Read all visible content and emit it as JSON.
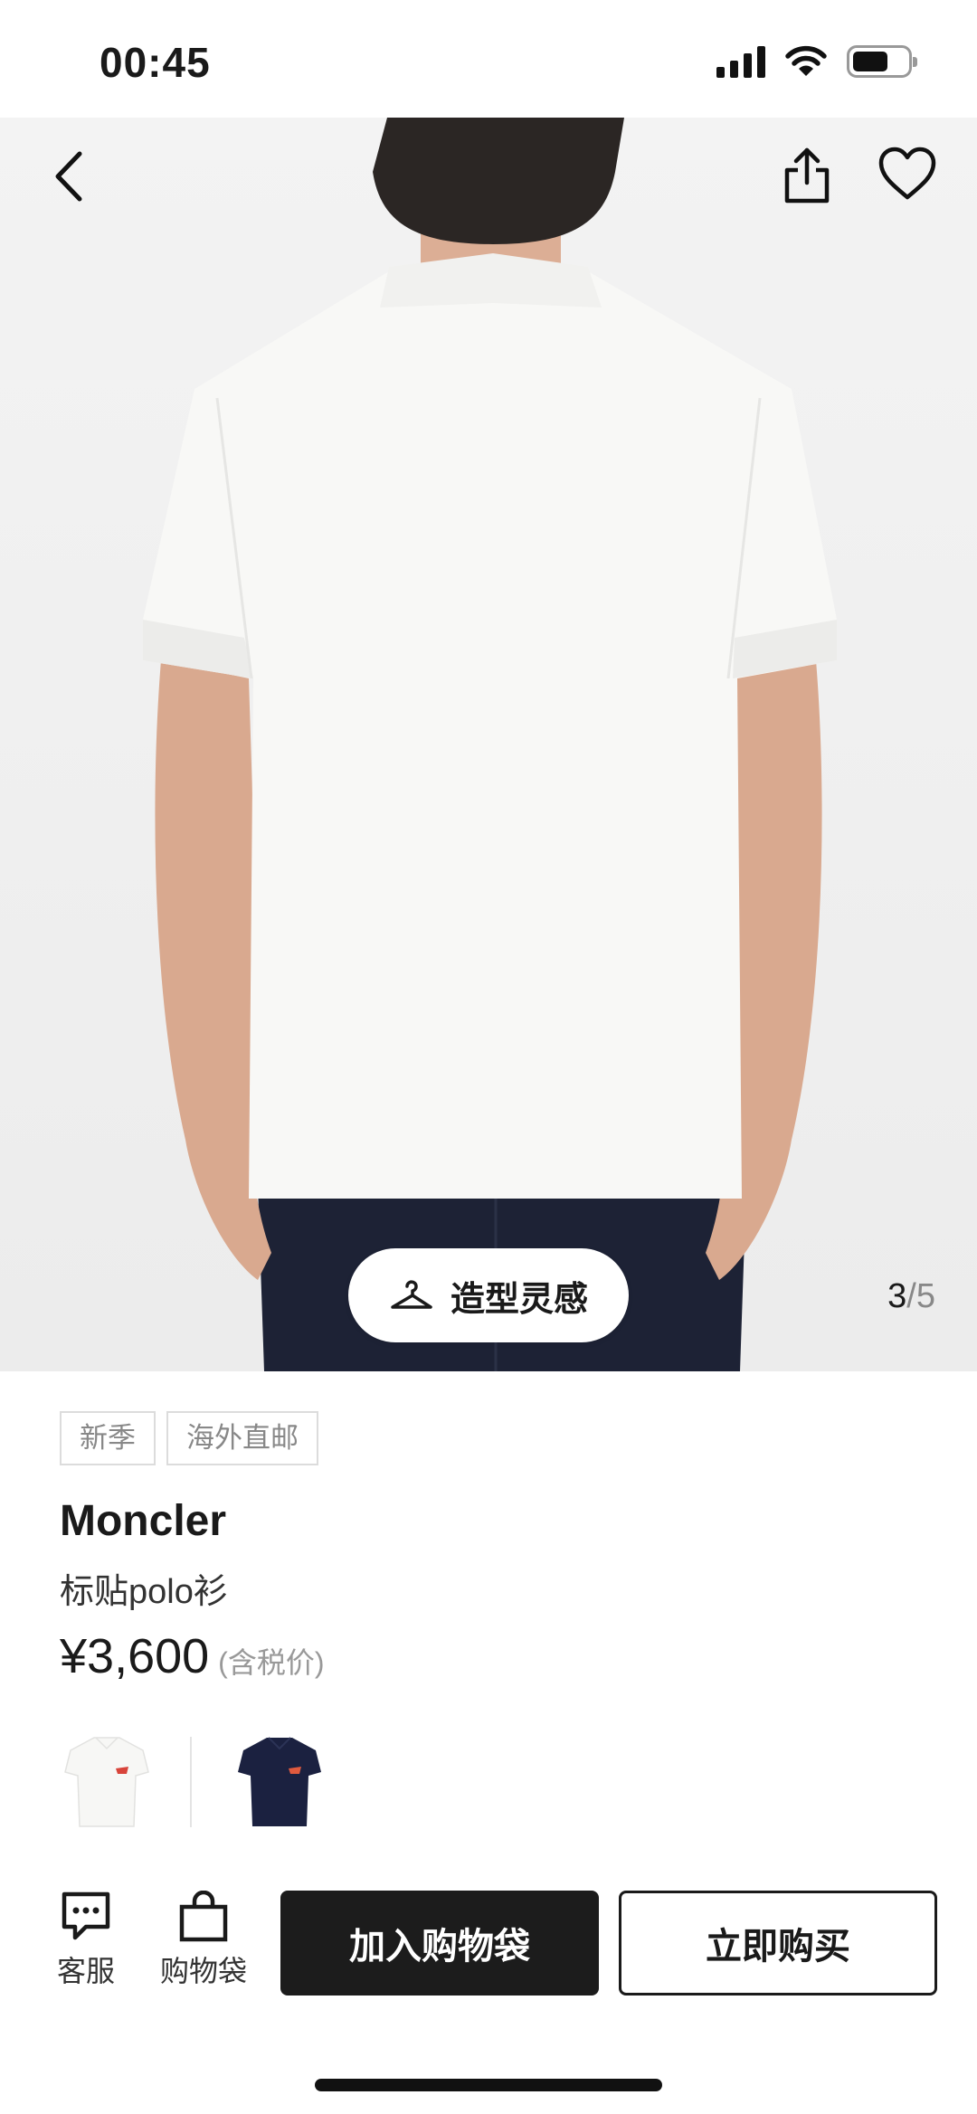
{
  "status_bar": {
    "time": "00:45",
    "icons": [
      "cellular-signal-icon",
      "wifi-icon",
      "battery-icon"
    ],
    "battery_level": 0.66
  },
  "top_nav": {
    "icons": [
      "back-arrow-icon",
      "share-icon",
      "heart-icon"
    ]
  },
  "gallery": {
    "style_button_label": "造型灵感",
    "current": "3",
    "separator": "/",
    "total": "5"
  },
  "product": {
    "tags": [
      "新季",
      "海外直邮"
    ],
    "brand": "Moncler",
    "name": "标贴polo衫",
    "price": "¥3,600",
    "tax_note": "(含税价)",
    "swatches": [
      {
        "color": "white",
        "hex": "#f7f7f5"
      },
      {
        "color": "navy",
        "hex": "#1b2140"
      }
    ]
  },
  "actions": {
    "service_label": "客服",
    "bag_label": "购物袋",
    "add_to_bag_label": "加入购物袋",
    "buy_now_label": "立即购买"
  },
  "colors": {
    "primary_button": "#1c1c1c",
    "text_primary": "#1a1a1a",
    "text_muted": "#888888"
  }
}
